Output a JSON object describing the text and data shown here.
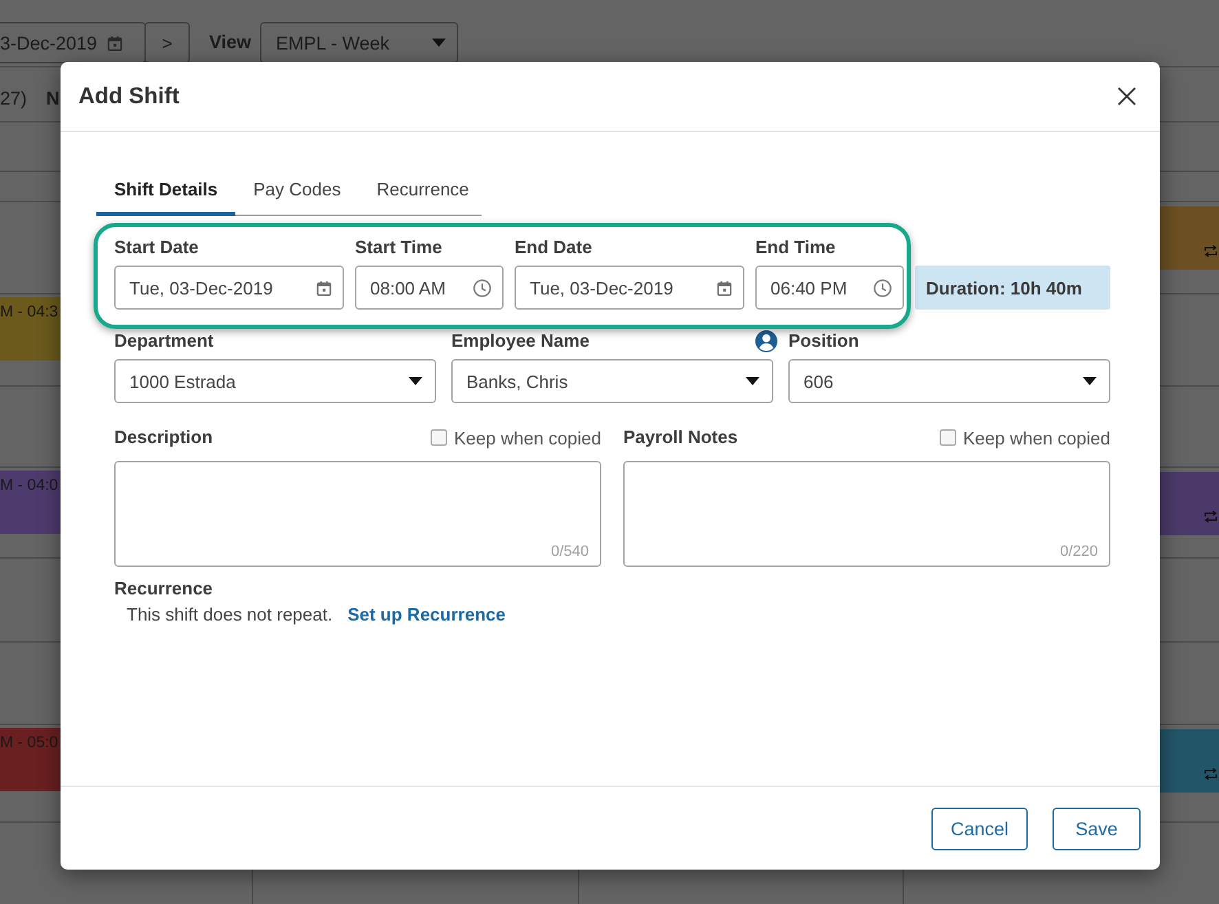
{
  "background": {
    "toolbar": {
      "date": "3-Dec-2019",
      "next_button": ">",
      "view_label": "View",
      "view_select": "EMPL - Week"
    },
    "header_row": {
      "count": "27)",
      "column_2": "N"
    },
    "left_shifts": [
      {
        "time": "M - 04:3",
        "color": "#6b5a1c"
      },
      {
        "time": "M - 04:0",
        "color": "#4e3b6d"
      },
      {
        "time": "M - 05:0",
        "color": "#6a2020"
      }
    ],
    "right_shifts": [
      {
        "color": "#6d5022",
        "recurring": true
      },
      {
        "color": "#4b3a69",
        "recurring": true
      },
      {
        "color": "#235569",
        "recurring": true
      }
    ]
  },
  "dialog": {
    "title": "Add Shift",
    "tabs": [
      {
        "label": "Shift Details",
        "selected": true
      },
      {
        "label": "Pay Codes",
        "selected": false
      },
      {
        "label": "Recurrence",
        "selected": false
      }
    ],
    "schedule_fields": [
      {
        "kind": "date",
        "label": "Start Date",
        "value": "Tue, 03-Dec-2019"
      },
      {
        "kind": "time",
        "label": "Start Time",
        "value": "08:00 AM"
      },
      {
        "kind": "date",
        "label": "End Date",
        "value": "Tue, 03-Dec-2019"
      },
      {
        "kind": "time",
        "label": "End Time",
        "value": "06:40 PM"
      }
    ],
    "duration": "Duration: 10h 40m",
    "selects": [
      {
        "label": "Department",
        "value": "1000 Estrada",
        "profile_button": false
      },
      {
        "label": "Employee Name",
        "value": "Banks, Chris",
        "profile_button": true
      },
      {
        "label": "Position",
        "value": "606",
        "profile_button": false
      }
    ],
    "notes": [
      {
        "label": "Description",
        "keep_label": "Keep when copied",
        "checked": false,
        "counter": "0/540"
      },
      {
        "label": "Payroll Notes",
        "keep_label": "Keep when copied",
        "checked": false,
        "counter": "0/220"
      }
    ],
    "recurrence": {
      "label": "Recurrence",
      "summary": "This shift does not repeat.",
      "link": "Set up Recurrence"
    },
    "buttons": [
      "Cancel",
      "Save"
    ]
  }
}
